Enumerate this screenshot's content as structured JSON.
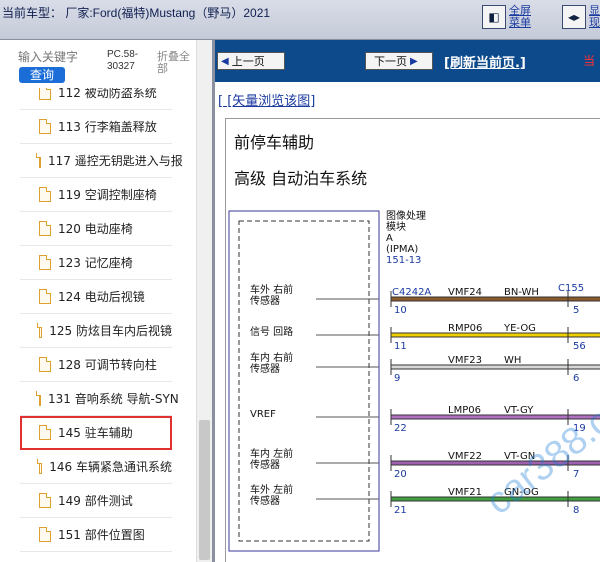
{
  "topbar": {
    "vehicle_text": "当前车型： 厂家:Ford(福特)Mustang（野马）2021",
    "fullscreen_label_1": "全屏",
    "fullscreen_label_2": "菜单",
    "show_label_1": "显",
    "show_label_2": "现"
  },
  "search": {
    "placeholder": "输入关键字",
    "button": "查询",
    "model_code": "PC.58-30327",
    "collapse_all": "折叠全部"
  },
  "tree": {
    "items": [
      {
        "label": "112 被动防盗系统"
      },
      {
        "label": "113 行李箱盖释放"
      },
      {
        "label": "117 遥控无钥匙进入与报"
      },
      {
        "label": "119 空调控制座椅"
      },
      {
        "label": "120 电动座椅"
      },
      {
        "label": "123 记忆座椅"
      },
      {
        "label": "124 电动后视镜"
      },
      {
        "label": "125 防炫目车内后视镜"
      },
      {
        "label": "128 可调节转向柱"
      },
      {
        "label": "131 音响系统 导航-SYN"
      },
      {
        "label": "145 驻车辅助",
        "selected": true
      },
      {
        "label": "146 车辆紧急通讯系统"
      },
      {
        "label": "149 部件测试"
      },
      {
        "label": "151 部件位置图"
      }
    ]
  },
  "nav": {
    "prev": "上一页",
    "next": "下一页",
    "refresh": "[刷新当前页.]",
    "current": "当"
  },
  "doc": {
    "vector_link": "[ [矢量浏览该图]",
    "title1": "前停车辅助",
    "title2": "高级 自动泊车系统",
    "module": {
      "line1": "图像处理",
      "line2": "模块",
      "line3": "A",
      "line4": "(IPMA)",
      "ref": "151-13"
    },
    "connectors": {
      "left": "C4242A",
      "right": "C155"
    },
    "wires": [
      {
        "label1": "车外 右前",
        "label2": "传感器",
        "circuit": "VMF24",
        "color_code": "BN-WH",
        "pin_left": "10",
        "pin_right": "5",
        "color": "#8b5a2b"
      },
      {
        "label1": "信号 回路",
        "label2": "",
        "circuit": "RMP06",
        "color_code": "YE-OG",
        "pin_left": "11",
        "pin_right": "56",
        "color": "#f0d000"
      },
      {
        "label1": "车内 右前",
        "label2": "传感器",
        "circuit": "VMF23",
        "color_code": "WH",
        "pin_left": "9",
        "pin_right": "6",
        "color": "#d8d8d8"
      },
      {
        "label1": "VREF",
        "label2": "",
        "circuit": "LMP06",
        "color_code": "VT-GY",
        "pin_left": "22",
        "pin_right": "19",
        "color": "#b070c0"
      },
      {
        "label1": "车内 左前",
        "label2": "传感器",
        "circuit": "VMF22",
        "color_code": "VT-GN",
        "pin_left": "20",
        "pin_right": "7",
        "color": "#a060b0"
      },
      {
        "label1": "车外 左前",
        "label2": "传感器",
        "circuit": "VMF21",
        "color_code": "GN-OG",
        "pin_left": "21",
        "pin_right": "8",
        "color": "#40a040"
      }
    ],
    "watermark": "car388.com"
  }
}
